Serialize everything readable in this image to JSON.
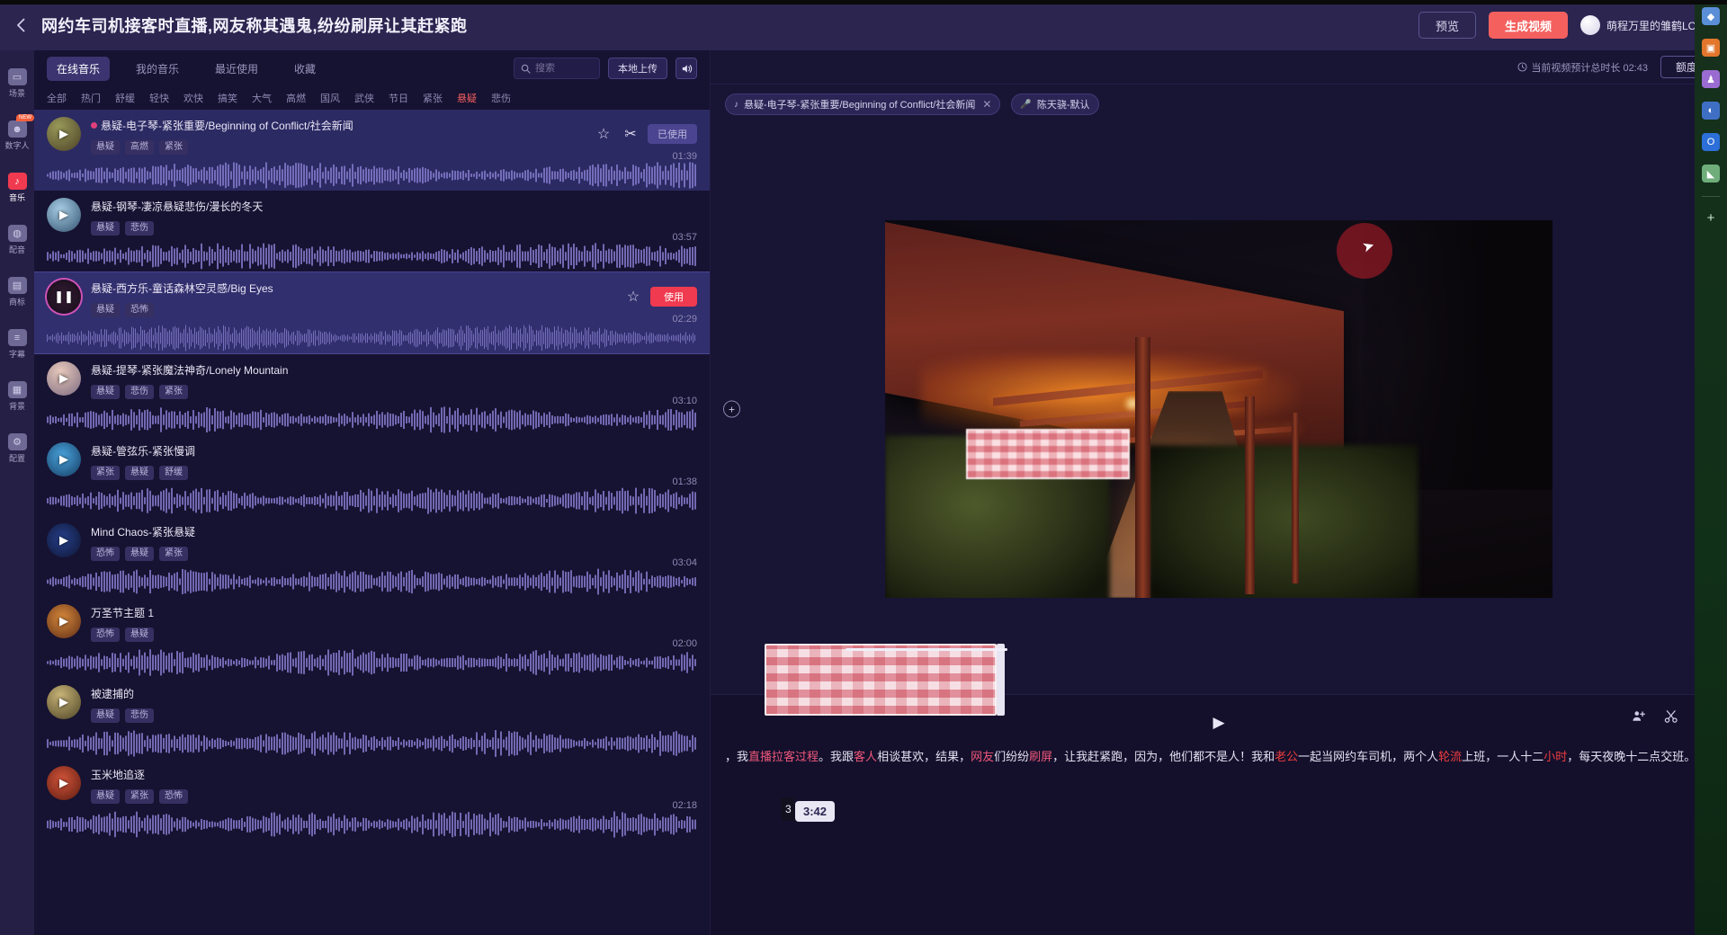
{
  "topbar": {
    "back_icon": "chevron-left-icon",
    "project_title": "网约车司机接客时直播,网友称其遇鬼,纷纷刷屏让其赶紧跑",
    "preview_label": "预览",
    "generate_label": "生成视频",
    "user_name": "萌程万里的雏鹤LORZ"
  },
  "rail": {
    "items": [
      {
        "label": "场景",
        "icon": "scene-icon",
        "badge": ""
      },
      {
        "label": "数字人",
        "icon": "avatar-person-icon",
        "badge": "NEW"
      },
      {
        "label": "音乐",
        "icon": "music-icon",
        "badge": ""
      },
      {
        "label": "配音",
        "icon": "voice-icon",
        "badge": ""
      },
      {
        "label": "商标",
        "icon": "logo-icon",
        "badge": ""
      },
      {
        "label": "字幕",
        "icon": "subtitle-icon",
        "badge": ""
      },
      {
        "label": "背景",
        "icon": "background-icon",
        "badge": ""
      },
      {
        "label": "配置",
        "icon": "settings-icon",
        "badge": ""
      }
    ],
    "active_index": 2
  },
  "music_panel": {
    "tabs": [
      {
        "label": "在线音乐",
        "active": true
      },
      {
        "label": "我的音乐",
        "active": false
      },
      {
        "label": "最近使用",
        "active": false
      },
      {
        "label": "收藏",
        "active": false
      }
    ],
    "search_placeholder": "搜索",
    "search_value": "",
    "upload_label": "本地上传",
    "volume_icon": "volume-icon",
    "categories": [
      "全部",
      "热门",
      "舒缓",
      "轻快",
      "欢快",
      "搞笑",
      "大气",
      "高燃",
      "国风",
      "武侠",
      "节日",
      "紧张",
      "悬疑",
      "悲伤"
    ],
    "active_category": "悬疑",
    "used_label": "已使用",
    "use_label": "使用",
    "tracks": [
      {
        "name": "悬疑-电子琴-紧张重要/Beginning of Conflict/社会新闻",
        "tags": [
          "悬疑",
          "高燃",
          "紧张"
        ],
        "duration": "01:39",
        "state": "selected",
        "action": "used",
        "has_dot": true
      },
      {
        "name": "悬疑-钢琴-凄凉悬疑悲伤/漫长的冬天",
        "tags": [
          "悬疑",
          "悲伤"
        ],
        "duration": "03:57",
        "state": "normal",
        "action": "none",
        "has_dot": false
      },
      {
        "name": "悬疑-西方乐-童话森林空灵感/Big Eyes",
        "tags": [
          "悬疑",
          "恐怖"
        ],
        "duration": "02:29",
        "state": "playing",
        "action": "use",
        "has_dot": false
      },
      {
        "name": "悬疑-提琴-紧张魔法神奇/Lonely Mountain",
        "tags": [
          "悬疑",
          "悲伤",
          "紧张"
        ],
        "duration": "03:10",
        "state": "normal",
        "action": "none",
        "has_dot": false
      },
      {
        "name": "悬疑-管弦乐-紧张慢调",
        "tags": [
          "紧张",
          "悬疑",
          "舒缓"
        ],
        "duration": "01:38",
        "state": "normal",
        "action": "none",
        "has_dot": false
      },
      {
        "name": "Mind Chaos-紧张悬疑",
        "tags": [
          "恐怖",
          "悬疑",
          "紧张"
        ],
        "duration": "03:04",
        "state": "normal",
        "action": "none",
        "has_dot": false
      },
      {
        "name": "万圣节主题 1",
        "tags": [
          "恐怖",
          "悬疑"
        ],
        "duration": "02:00",
        "state": "normal",
        "action": "none",
        "has_dot": false
      },
      {
        "name": "被逮捕的",
        "tags": [
          "悬疑",
          "悲伤"
        ],
        "duration": "",
        "state": "normal",
        "action": "none",
        "has_dot": false
      },
      {
        "name": "玉米地追逐",
        "tags": [
          "悬疑",
          "紧张",
          "恐怖"
        ],
        "duration": "02:18",
        "state": "normal",
        "action": "none",
        "has_dot": false
      }
    ]
  },
  "workspace": {
    "duration_note": "当前视频预计总时长 02:43",
    "quota_label": "额度",
    "chips": [
      {
        "icon": "music-note-icon",
        "label": "悬疑-电子琴-紧张重要/Beginning of Conflict/社会新闻",
        "closable": true
      },
      {
        "icon": "mic-icon",
        "label": "陈天骁-默认",
        "closable": false
      }
    ],
    "stage": {
      "add_left_icon": "plus-circle-icon",
      "add_right_icon": "plus-circle-icon"
    },
    "timeline": {
      "play_icon": "play-icon",
      "time_badge": "3:42",
      "time_badge_left": "3",
      "tools": [
        {
          "icon": "person-add-icon"
        },
        {
          "icon": "scissors-icon"
        },
        {
          "icon": "settings-gear-icon"
        }
      ],
      "transcript_segments": [
        {
          "text": "，我",
          "style": "normal"
        },
        {
          "text": "直播拉客过程",
          "style": "pink"
        },
        {
          "text": "。我跟",
          "style": "normal"
        },
        {
          "text": "客人",
          "style": "pink"
        },
        {
          "text": "相谈甚欢，结果，",
          "style": "normal"
        },
        {
          "text": "网友",
          "style": "pink"
        },
        {
          "text": "们纷纷",
          "style": "normal"
        },
        {
          "text": "刷屏",
          "style": "pink"
        },
        {
          "text": "，让我赶紧跑，因为，他们都不是人！我和",
          "style": "normal"
        },
        {
          "text": "老公",
          "style": "red"
        },
        {
          "text": "一起当网约车司机，两个人",
          "style": "normal"
        },
        {
          "text": "轮流",
          "style": "red"
        },
        {
          "text": "上班，一人十二",
          "style": "normal"
        },
        {
          "text": "小时",
          "style": "red"
        },
        {
          "text": "，每天夜晚十二点交班。",
          "style": "normal"
        }
      ]
    }
  },
  "desktop_strip": {
    "icons": [
      {
        "name": "shield-icon",
        "color": "#5a8fd8"
      },
      {
        "name": "briefcase-icon",
        "color": "#e2762c"
      },
      {
        "name": "people-icon",
        "color": "#9a6bd0"
      },
      {
        "name": "browser-icon",
        "color": "#3f6fc4"
      },
      {
        "name": "outlook-icon",
        "color": "#2c6fd8"
      },
      {
        "name": "flag-icon",
        "color": "#6fae7a"
      }
    ],
    "add_icon": "plus-icon"
  }
}
